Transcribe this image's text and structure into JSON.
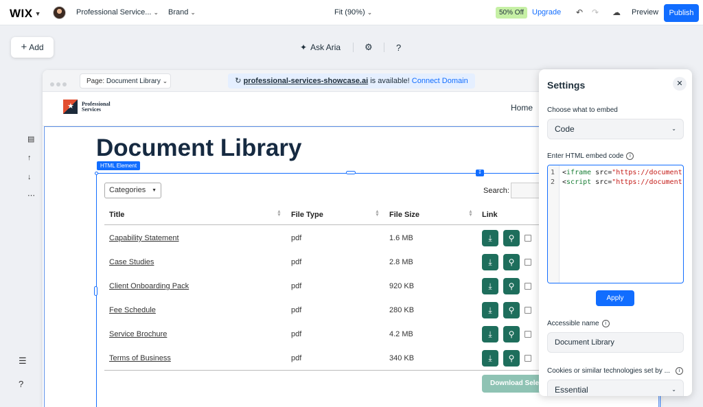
{
  "topbar": {
    "logo": "WIX",
    "site_name": "Professional Service...",
    "brand": "Brand",
    "zoom": "Fit (90%)",
    "offer_badge": "50% Off",
    "upgrade": "Upgrade",
    "preview": "Preview",
    "publish": "Publish"
  },
  "toolbar": {
    "add": "Add",
    "ask_aria": "Ask Aria",
    "help": "?"
  },
  "rail": {
    "help": "?"
  },
  "browser": {
    "page_label": "Page:",
    "page_name": "Document Library",
    "domain": "professional-services-showcase.ai",
    "domain_suffix": " is available! ",
    "connect": "Connect Domain"
  },
  "site": {
    "brand_line1": "Professional",
    "brand_line2": "Services",
    "nav_home": "Home",
    "page_title": "Document Library",
    "element_tag": "HTML Element"
  },
  "table": {
    "filter": "Categories",
    "search_label": "Search:",
    "headers": [
      "Title",
      "File Type",
      "File Size",
      "Link"
    ],
    "rows": [
      {
        "title": "Capability Statement",
        "type": "pdf",
        "size": "1.6 MB"
      },
      {
        "title": "Case Studies",
        "type": "pdf",
        "size": "2.8 MB"
      },
      {
        "title": "Client Onboarding Pack",
        "type": "pdf",
        "size": "920 KB"
      },
      {
        "title": "Fee Schedule",
        "type": "pdf",
        "size": "280 KB"
      },
      {
        "title": "Service Brochure",
        "type": "pdf",
        "size": "4.2 MB"
      },
      {
        "title": "Terms of Business",
        "type": "pdf",
        "size": "340 KB"
      }
    ],
    "download_selected": "Download Selected"
  },
  "settings": {
    "title": "Settings",
    "embed_label": "Choose what to embed",
    "embed_value": "Code",
    "code_label": "Enter HTML embed code",
    "code_lines": [
      {
        "num": "1",
        "open": "<",
        "tag": "iframe",
        "attr": " src=",
        "str": "\"https://document"
      },
      {
        "num": "2",
        "open": "<",
        "tag": "script",
        "attr": " src=",
        "str": "\"https://document"
      }
    ],
    "apply": "Apply",
    "accessible_label": "Accessible name",
    "accessible_value": "Document Library",
    "cookies_label": "Cookies or similar technologies set by ...",
    "cookies_value": "Essential"
  },
  "colors": {
    "accent": "#116dff",
    "action_green": "#1e6e5c",
    "offer_green": "#c6f0a5"
  }
}
